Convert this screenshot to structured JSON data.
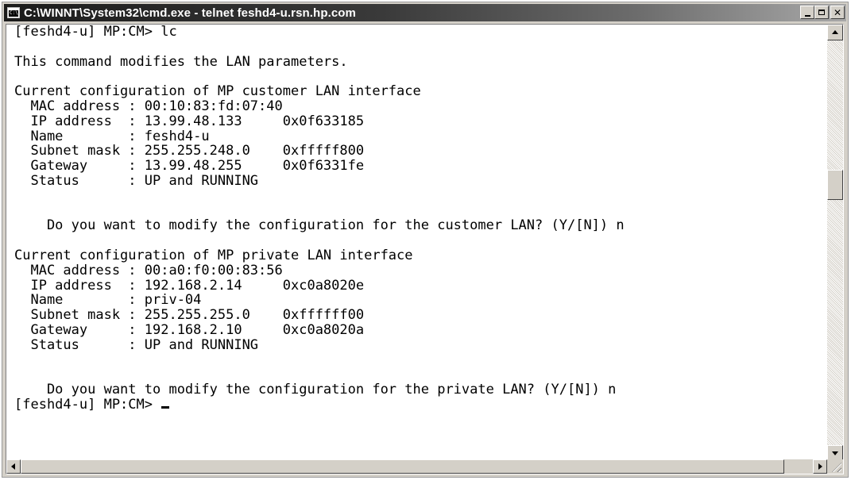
{
  "window": {
    "title": "C:\\WINNT\\System32\\cmd.exe - telnet feshd4-u.rsn.hp.com",
    "icon": "cmd-icon"
  },
  "caption_buttons": {
    "minimize": "minimize-icon",
    "maximize": "maximize-icon",
    "close_label": "✕"
  },
  "console": {
    "lines": [
      "[feshd4-u] MP:CM> lc",
      "",
      "This command modifies the LAN parameters.",
      "",
      "Current configuration of MP customer LAN interface",
      "  MAC address : 00:10:83:fd:07:40",
      "  IP address  : 13.99.48.133     0x0f633185",
      "  Name        : feshd4-u",
      "  Subnet mask : 255.255.248.0    0xfffff800",
      "  Gateway     : 13.99.48.255     0x0f6331fe",
      "  Status      : UP and RUNNING",
      "",
      "",
      "    Do you want to modify the configuration for the customer LAN? (Y/[N]) n",
      "",
      "Current configuration of MP private LAN interface",
      "  MAC address : 00:a0:f0:00:83:56",
      "  IP address  : 192.168.2.14     0xc0a8020e",
      "  Name        : priv-04",
      "  Subnet mask : 255.255.255.0    0xffffff00",
      "  Gateway     : 192.168.2.10     0xc0a8020a",
      "  Status      : UP and RUNNING",
      "",
      "",
      "    Do you want to modify the configuration for the private LAN? (Y/[N]) n",
      "[feshd4-u] MP:CM> "
    ]
  },
  "scrollbars": {
    "vertical_position": 0.33,
    "horizontal_position": 0.0
  }
}
